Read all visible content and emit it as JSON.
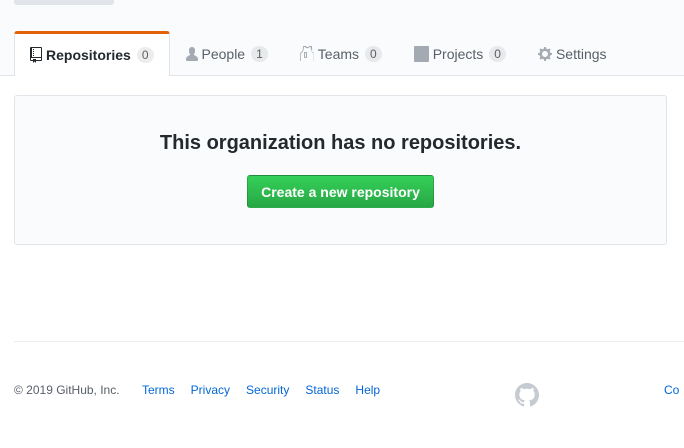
{
  "tabs": [
    {
      "label": "Repositories",
      "count": "0",
      "icon": "repo-icon",
      "selected": true
    },
    {
      "label": "People",
      "count": "1",
      "icon": "person-icon"
    },
    {
      "label": "Teams",
      "count": "0",
      "icon": "jersey-icon"
    },
    {
      "label": "Projects",
      "count": "0",
      "icon": "project-icon"
    },
    {
      "label": "Settings",
      "icon": "gear-icon"
    }
  ],
  "blankslate": {
    "title": "This organization has no repositories.",
    "button_label": "Create a new repository"
  },
  "footer": {
    "copyright": "© 2019 GitHub, Inc.",
    "links": [
      "Terms",
      "Privacy",
      "Security",
      "Status",
      "Help"
    ],
    "logo_icon": "github-mark-icon",
    "right_link": "Co"
  },
  "colors": {
    "accent_tab": "#e36209",
    "primary_button": "#28a745",
    "link": "#0366d6"
  }
}
